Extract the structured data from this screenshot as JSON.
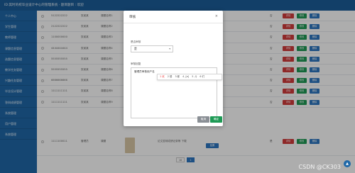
{
  "topbar": {
    "title": "ID:其时的校毕业设计中心的管理系统 · 题目题目 : 欢迎"
  },
  "sidebar": {
    "items": [
      "个人中心",
      "学生管理",
      "教师管理",
      "课题信息管理",
      "选题信息管理",
      "教学任务管理",
      "兴趣任务管理",
      "毕业设计管理",
      "答辩成绩管理",
      "系统管理",
      "用户管理",
      "系统管理"
    ]
  },
  "table": {
    "rows": [
      {
        "id": "5122222222",
        "name": "张某某",
        "course": "课题名称1",
        "state": "否"
      },
      {
        "id": "2122222222",
        "name": "张某某",
        "course": "课题名称2",
        "state": "否"
      },
      {
        "id": "1100000000",
        "name": "张某某",
        "course": "课题名称3",
        "state": "否"
      },
      {
        "id": "4444444444",
        "name": "张某某",
        "course": "课题名称4",
        "state": "否"
      },
      {
        "id": "5555555555",
        "name": "张某某",
        "course": "课题名称5",
        "state": "否"
      },
      {
        "id": "5555555555",
        "name": "张某某",
        "course": "课题名称6",
        "state": "否"
      },
      {
        "id": "6666666666",
        "name": "张某某",
        "course": "课题名称7",
        "state": "否"
      },
      {
        "id": "1111111111",
        "name": "张某某",
        "course": "课题名称8",
        "state": "否"
      },
      {
        "id": "1111111111",
        "name": "张某某",
        "course": "课题名称9",
        "state": "否"
      },
      {
        "id": "1111100011",
        "name": "管理员",
        "course": "课题",
        "state": "是"
      }
    ],
    "btn_red": "详情",
    "btn_green": "修改",
    "btn_blue": "删除",
    "extra_link": "结果",
    "extra_text": "论文答辩成绩记录等 下载"
  },
  "dialog": {
    "title": "审核",
    "close": "×",
    "status_label": "是否审核",
    "status_value": "是",
    "remark_label": "审核回复",
    "remark_text": "管理员审核用户名",
    "ime_candidates": [
      "1 欢",
      "2 楼",
      "3 都",
      "4 ,[e]",
      "5 ,Q",
      "6 们"
    ],
    "cancel": "取消",
    "confirm": "确定"
  },
  "pager": {
    "size": "10",
    "page": "1"
  },
  "watermark": "CSDN @CK303"
}
